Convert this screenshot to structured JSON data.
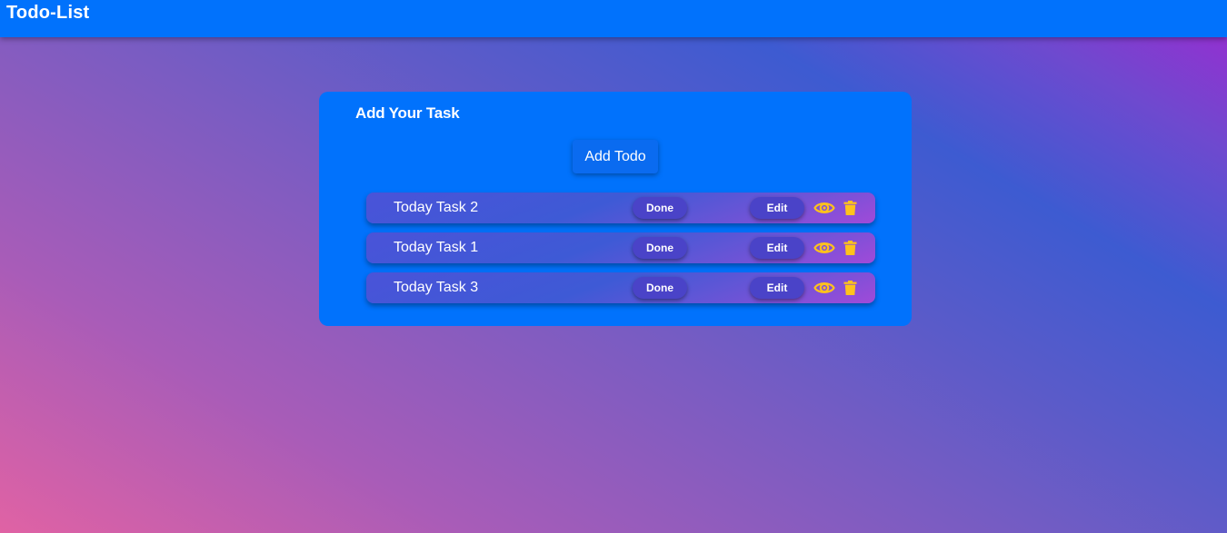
{
  "header": {
    "title": "Todo-List"
  },
  "card": {
    "heading": "Add Your Task",
    "add_button_label": "Add Todo"
  },
  "tasks": [
    {
      "text": "Today Task 2",
      "done_label": "Done",
      "edit_label": "Edit",
      "view_icon": "eye-icon",
      "delete_icon": "trash-icon"
    },
    {
      "text": "Today Task 1",
      "done_label": "Done",
      "edit_label": "Edit",
      "view_icon": "eye-icon",
      "delete_icon": "trash-icon"
    },
    {
      "text": "Today Task 3",
      "done_label": "Done",
      "edit_label": "Edit",
      "view_icon": "eye-icon",
      "delete_icon": "trash-icon"
    }
  ],
  "colors": {
    "header_bg": "#0172fc",
    "card_bg": "#0172fc",
    "icon_yellow": "#ffc21c",
    "pill_bg": "#4a43c8"
  }
}
